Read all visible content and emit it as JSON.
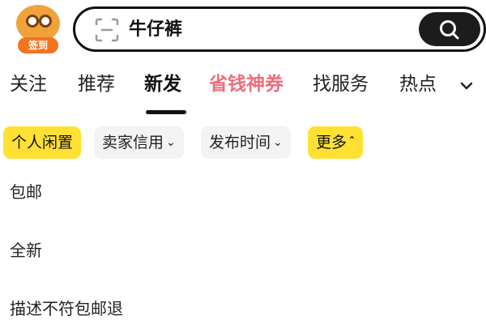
{
  "sign_in": {
    "label": "签到"
  },
  "search": {
    "query": "牛仔裤"
  },
  "tabs": [
    {
      "label": "关注"
    },
    {
      "label": "推荐"
    },
    {
      "label": "新发"
    },
    {
      "label": "省钱神券"
    },
    {
      "label": "找服务"
    },
    {
      "label": "热点"
    }
  ],
  "active_tab": "新发",
  "filters": [
    {
      "label": "个人闲置",
      "selected": true
    },
    {
      "label": "卖家信用"
    },
    {
      "label": "发布时间"
    },
    {
      "label": "更多",
      "expanded": true
    }
  ],
  "more_options": [
    {
      "label": "包邮"
    },
    {
      "label": "全新"
    },
    {
      "label": "描述不符包邮退"
    }
  ],
  "colors": {
    "accent_yellow": "#ffe033",
    "promo_pink": "#ee6d7a",
    "badge_orange": "#f2741f",
    "dark": "#1c1c1c"
  }
}
